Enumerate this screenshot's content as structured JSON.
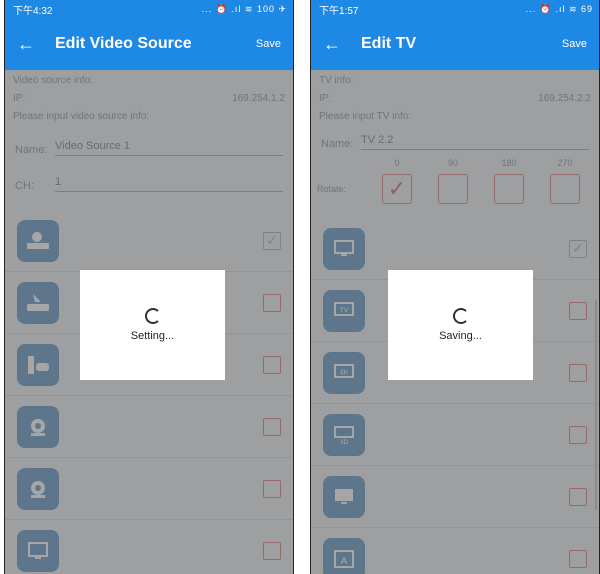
{
  "left": {
    "status": {
      "time": "下午4:32",
      "icons": "... ⏰ .ıl ≋ 100 ✈"
    },
    "appbar": {
      "title": "Edit Video Source",
      "save": "Save",
      "back_icon": "arrow-left-icon"
    },
    "info_label": "Video source info:",
    "ip_label": "IP:",
    "ip_value": "169.254.1.2",
    "input_hint": "Please input video source info:",
    "name_label": "Name:",
    "name_value": "Video Source 1",
    "ch_label": "CH:",
    "ch_value": "1",
    "list": [
      {
        "icon": "dvd-player-icon",
        "checked": true
      },
      {
        "icon": "satellite-receiver-icon",
        "checked": false
      },
      {
        "icon": "game-console-icon",
        "checked": false
      },
      {
        "icon": "camera-icon",
        "checked": false
      },
      {
        "icon": "camera-2-icon",
        "checked": false
      },
      {
        "icon": "monitor-1-icon",
        "checked": false
      }
    ],
    "dialog": {
      "message": "Setting..."
    }
  },
  "right": {
    "status": {
      "time": "下午1:57",
      "icons": "... ⏰ .ıl ≋ 69"
    },
    "appbar": {
      "title": "Edit TV",
      "save": "Save",
      "back_icon": "arrow-left-icon"
    },
    "info_label": "TV info:",
    "ip_label": "IP:",
    "ip_value": "169.254.2.2",
    "input_hint": "Please input TV info:",
    "name_label": "Name:",
    "name_value": "TV 2.2",
    "rotate_label": "Rotate:",
    "rotate_options": [
      "0",
      "90",
      "180",
      "270"
    ],
    "rotate_checked": "0",
    "list": [
      {
        "icon": "monitor-icon",
        "label": "",
        "checked": true
      },
      {
        "icon": "tv-icon",
        "label": "TV",
        "checked": false
      },
      {
        "icon": "4k-icon",
        "label": "4K",
        "checked": false
      },
      {
        "icon": "3d-icon",
        "label": "3D",
        "checked": false
      },
      {
        "icon": "display-icon",
        "label": "",
        "checked": false
      },
      {
        "icon": "a-icon",
        "label": "A",
        "checked": false
      }
    ],
    "dialog": {
      "message": "Saving..."
    }
  }
}
